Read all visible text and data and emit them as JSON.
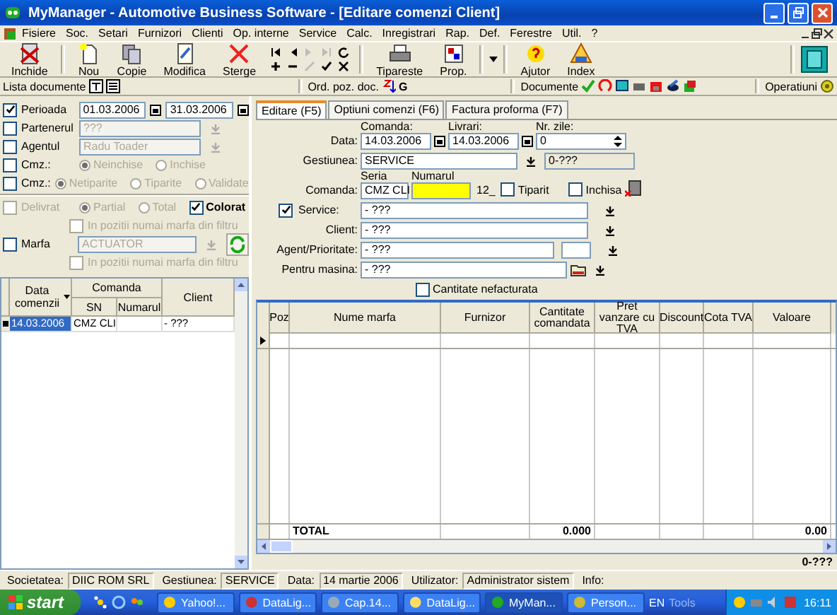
{
  "window": {
    "title": "MyManager - Automotive Business Software - [Editare comenzi Client]"
  },
  "menu": [
    "Fisiere",
    "Soc.",
    "Setari",
    "Furnizori",
    "Clienti",
    "Op. interne",
    "Service",
    "Calc.",
    "Inregistrari",
    "Rap.",
    "Def.",
    "Ferestre",
    "Util.",
    "?"
  ],
  "toolbar": [
    {
      "label": "Inchide",
      "kind": "close"
    },
    {
      "label": "Nou",
      "kind": "new"
    },
    {
      "label": "Copie",
      "kind": "copy"
    },
    {
      "label": "Modifica",
      "kind": "edit"
    },
    {
      "label": "Sterge",
      "kind": "delete"
    },
    {
      "label": "Tipareste",
      "kind": "print"
    },
    {
      "label": "Prop.",
      "kind": "props"
    },
    {
      "label": "Ajutor",
      "kind": "help"
    },
    {
      "label": "Index",
      "kind": "index"
    }
  ],
  "toolbar2": {
    "list_label": "Lista documente",
    "order_label": "Ord. poz. doc.",
    "order_key": "G",
    "documents_label": "Documente",
    "operations_label": "Operatiuni"
  },
  "filters": [
    {
      "kind": "dates",
      "label": "Perioada",
      "checked": true,
      "from": "01.03.2006",
      "to": "31.03.2006"
    },
    {
      "kind": "field",
      "label": "Partenerul",
      "checked": false,
      "value": "???"
    },
    {
      "kind": "field",
      "label": "Agentul",
      "checked": false,
      "value": "Radu Toader"
    },
    {
      "kind": "radios",
      "label": "Cmz.:",
      "checked": false,
      "options": [
        {
          "label": "Neinchise",
          "selected": true
        },
        {
          "label": "Inchise",
          "selected": false
        }
      ]
    },
    {
      "kind": "radios",
      "label": "Cmz.:",
      "checked": false,
      "options": [
        {
          "label": "Netiparite",
          "selected": true
        },
        {
          "label": "Tiparite",
          "selected": false
        },
        {
          "label": "Validate",
          "selected": false
        }
      ]
    },
    {
      "kind": "radios",
      "label": "Delivrat",
      "checked": false,
      "disabled": true,
      "options": [
        {
          "label": "Partial",
          "selected": true
        },
        {
          "label": "Total",
          "selected": false
        }
      ],
      "extra": {
        "label": "Colorat",
        "checked": true
      },
      "sub": {
        "label": "In pozitii numai marfa din filtru",
        "checked": false
      }
    },
    {
      "kind": "field",
      "label": "Marfa",
      "checked": false,
      "value": "ACTUATOR",
      "refresh": true,
      "sub": {
        "label": "In pozitii numai marfa din filtru",
        "checked": false
      }
    }
  ],
  "list": {
    "columns": {
      "date": "Data comenzii",
      "group": "Comanda",
      "sn": "SN",
      "number": "Numarul",
      "client": "Client"
    },
    "rows": [
      {
        "date": "14.03.2006",
        "sn": "CMZ CLI",
        "client": "- ???",
        "selected": true
      }
    ]
  },
  "tabs": [
    {
      "label": "Editare (F5)",
      "selected": true
    },
    {
      "label": "Optiuni comenzi (F6)",
      "selected": false
    },
    {
      "label": "Factura proforma (F7)",
      "selected": false
    }
  ],
  "form": {
    "data_label": "Data:",
    "comanda_label": "Comanda:",
    "comanda": "14.03.2006",
    "livrari_label": "Livrari:",
    "livrari": "14.03.2006",
    "nr_zile_label": "Nr. zile:",
    "nr_zile": "0",
    "gestiunea_label": "Gestiunea:",
    "gestiunea": "SERVICE",
    "gestiunea_code": "0-???",
    "order_label": "Comanda:",
    "seria_label": "Seria",
    "seria": "CMZ CLI",
    "numarul_label": "Numarul",
    "suffix": "12_",
    "tiparit": {
      "label": "Tiparit",
      "checked": false
    },
    "inchisa": {
      "label": "Inchisa",
      "checked": false
    },
    "service": {
      "label": "Service:",
      "checked": true,
      "value": "- ???"
    },
    "client": {
      "label": "Client:",
      "value": "- ???"
    },
    "agent": {
      "label": "Agent/Prioritate:",
      "value": "- ???"
    },
    "masina": {
      "label": "Pentru masina:",
      "value": "- ???"
    },
    "nefacturata": {
      "label": "Cantitate nefacturata",
      "checked": false
    }
  },
  "grid": {
    "columns": [
      "Poz",
      "Nume marfa",
      "Furnizor",
      "Cantitate comandata",
      "Pret vanzare cu TVA",
      "Discount",
      "Cota TVA",
      "Valoare"
    ],
    "total_label": "TOTAL",
    "total_quantity": "0.000",
    "total_value": "0.00",
    "footer_code": "0-???"
  },
  "status_bar": [
    {
      "label": "Societatea:",
      "value": "DIIC ROM SRL"
    },
    {
      "label": "Gestiunea:",
      "value": "SERVICE"
    },
    {
      "label": "Data:",
      "value": "14 martie 2006"
    },
    {
      "label": "Utilizator:",
      "value": "Administrator sistem"
    },
    {
      "label": "Info:"
    }
  ],
  "taskbar": {
    "start": "start",
    "tasks": [
      {
        "label": "Yahoo!...",
        "selected": false
      },
      {
        "label": "DataLig...",
        "selected": false
      },
      {
        "label": "Cap.14...",
        "selected": false
      },
      {
        "label": "DataLig...",
        "selected": false
      },
      {
        "label": "MyMan...",
        "selected": true
      },
      {
        "label": "Person...",
        "selected": false
      }
    ],
    "lang": "EN",
    "tools": "Tools",
    "clock": "16:11"
  }
}
